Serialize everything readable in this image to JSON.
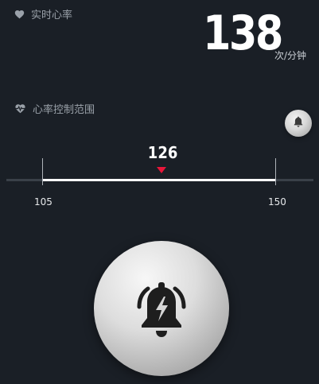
{
  "header": {
    "realtime_label": "实时心率",
    "bpm_value": "138",
    "bpm_unit": "次/分钟"
  },
  "range": {
    "label": "心率控制范围",
    "current": "126",
    "min": "105",
    "max": "150"
  },
  "colors": {
    "background": "#1a1f26",
    "marker": "#e8163a",
    "track": "#ffffff",
    "muted_text": "#9aa1a9"
  },
  "icons": {
    "header": "heart-icon",
    "range": "heart-pulse-icon",
    "small_button": "bell-icon",
    "big_button": "bell-alert-icon"
  }
}
